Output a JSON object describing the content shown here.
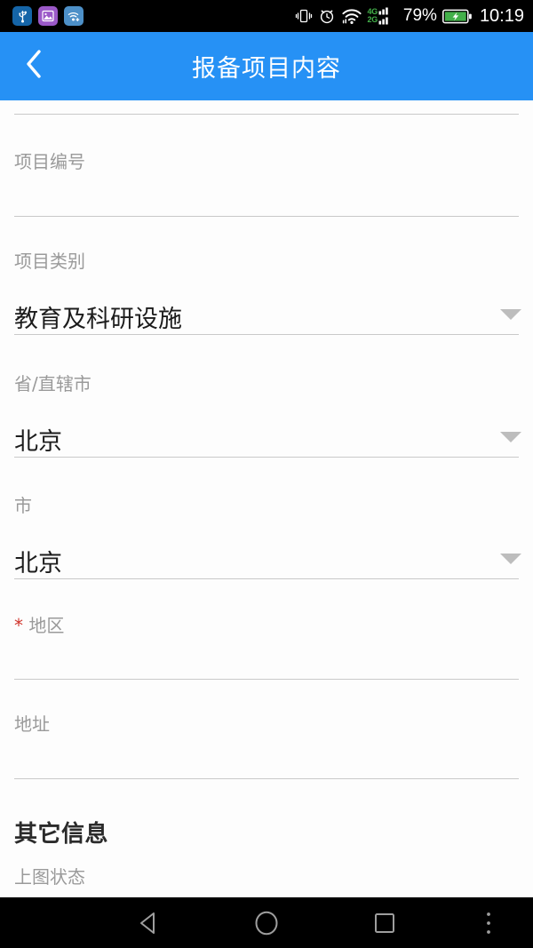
{
  "statusbar": {
    "left_icons": [
      {
        "name": "usb-icon",
        "label": "USB"
      },
      {
        "name": "screenshot-icon",
        "label": "Screenshot"
      },
      {
        "name": "wifi-share-icon",
        "label": "WiFi Share"
      }
    ],
    "vibrate_icon": "vibrate-icon",
    "alarm_icon": "alarm-icon",
    "wifi_icon": "wifi-icon",
    "network_primary": "4G",
    "network_secondary": "2G",
    "battery_percent": "79%",
    "battery_icon": "battery-charging-icon",
    "clock": "10:19"
  },
  "header": {
    "back_icon": "back-chevron-icon",
    "title": "报备项目内容"
  },
  "form": {
    "fields": [
      {
        "name": "project-number",
        "label": "项目编号",
        "value": "",
        "required": false,
        "has_dropdown": false
      },
      {
        "name": "project-category",
        "label": "项目类别",
        "value": "教育及科研设施",
        "required": false,
        "has_dropdown": true
      },
      {
        "name": "province",
        "label": "省/直辖市",
        "value": "北京",
        "required": false,
        "has_dropdown": true
      },
      {
        "name": "city",
        "label": "市",
        "value": "北京",
        "required": false,
        "has_dropdown": true
      },
      {
        "name": "district",
        "label": "地区",
        "value": "",
        "required": true,
        "required_mark": "*",
        "has_dropdown": false
      },
      {
        "name": "address",
        "label": "地址",
        "value": "",
        "required": false,
        "has_dropdown": false
      }
    ],
    "section_other_info": "其它信息",
    "mapping_status_label": "上图状态"
  },
  "navbar": {
    "back": "back-triangle-icon",
    "home": "home-circle-icon",
    "recents": "recents-square-icon",
    "menu": "overflow-menu-icon"
  },
  "colors": {
    "accent": "#2691f5",
    "required": "#d0342c",
    "divider": "#c9c9c9",
    "label": "#9a9a9a",
    "value": "#1c1c1c",
    "battery": "#43b04a"
  }
}
